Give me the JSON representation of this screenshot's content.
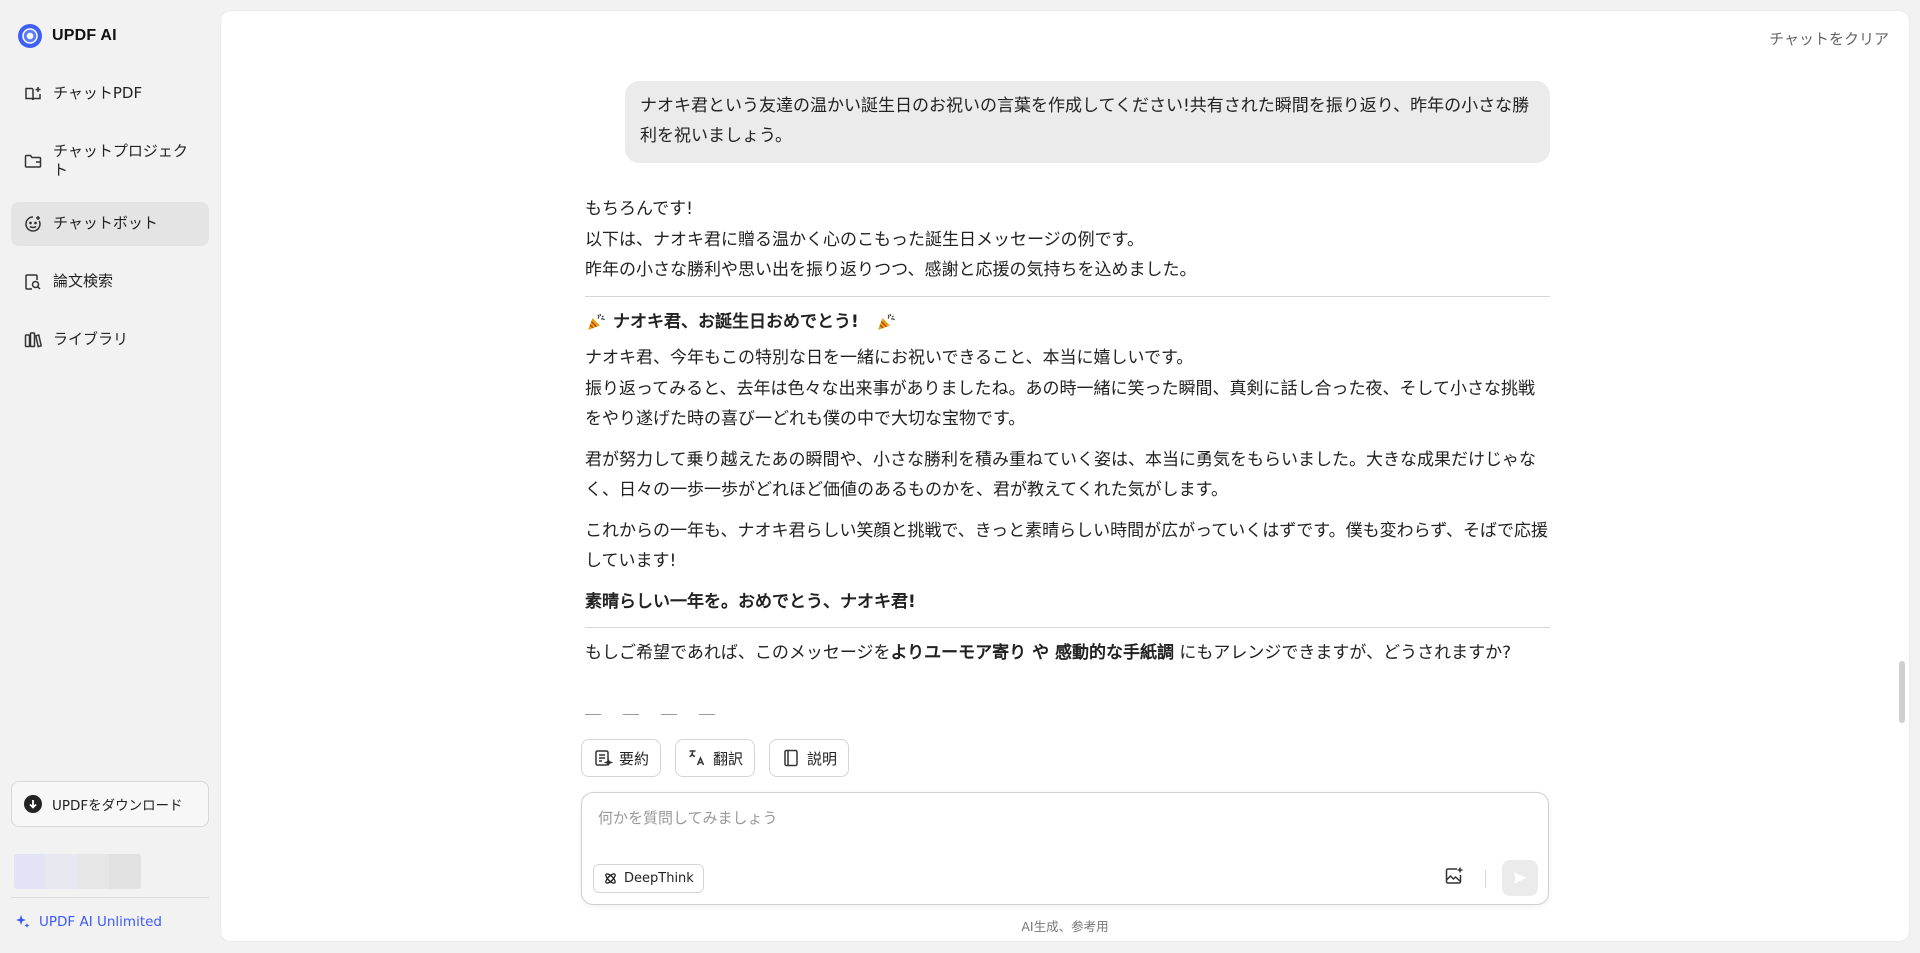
{
  "app": {
    "name": "UPDF AI"
  },
  "sidebar": {
    "items": [
      {
        "label": "チャットPDF",
        "icon": "book-icon",
        "active": false
      },
      {
        "label": "チャットプロジェクト",
        "icon": "folder-icon",
        "active": false
      },
      {
        "label": "チャットボット",
        "icon": "bot-icon",
        "active": true
      },
      {
        "label": "論文検索",
        "icon": "search-doc-icon",
        "active": false
      },
      {
        "label": "ライブラリ",
        "icon": "library-icon",
        "active": false
      }
    ],
    "download_label": "UPDFをダウンロード",
    "unlimited_label": "UPDF AI Unlimited"
  },
  "header": {
    "clear_label": "チャットをクリア"
  },
  "chat": {
    "user_message": "ナオキ君という友達の温かい誕生日のお祝いの言葉を作成してください!共有された瞬間を振り返り、昨年の小さな勝利を祝いましょう。",
    "answer": {
      "intro": [
        "もちろんです!",
        "以下は、ナオキ君に贈る温かく心のこもった誕生日メッセージの例です。",
        "昨年の小さな勝利や思い出を振り返りつつ、感謝と応援の気持ちを込めました。"
      ],
      "title": "ナオキ君、お誕生日おめでとう!",
      "paragraph1": "ナオキ君、今年もこの特別な日を一緒にお祝いできること、本当に嬉しいです。",
      "paragraph1b": "振り返ってみると、去年は色々な出来事がありましたね。あの時一緒に笑った瞬間、真剣に話し合った夜、そして小さな挑戦をやり遂げた時の喜び一どれも僕の中で大切な宝物です。",
      "paragraph2": "君が努力して乗り越えたあの瞬間や、小さな勝利を積み重ねていく姿は、本当に勇気をもらいました。大きな成果だけじゃなく、日々の一歩一歩がどれほど価値のあるものかを、君が教えてくれた気がします。",
      "paragraph3": "これからの一年も、ナオキ君らしい笑顔と挑戦で、きっと素晴らしい時間が広がっていくはずです。僕も変わらず、そばで応援しています!",
      "closing": "素晴らしい一年を。おめでとう、ナオキ君!",
      "followup_pre": "もしご希望であれば、このメッセージを",
      "followup_bold": "よりユーモア寄り や 感動的な手紙調",
      "followup_post": " にもアレンジできますが、どうされますか?"
    }
  },
  "quick_actions": [
    {
      "label": "要約",
      "icon": "summary-icon"
    },
    {
      "label": "翻訳",
      "icon": "translate-icon"
    },
    {
      "label": "説明",
      "icon": "explain-icon"
    }
  ],
  "input": {
    "placeholder": "何かを質問してみましょう",
    "value": "",
    "deepthink_label": "DeepThink"
  },
  "footer": {
    "note": "AI生成、参考用"
  },
  "colors": {
    "accent": "#3d5af1",
    "sidebar_bg": "#f2f2f2",
    "active_item_bg": "#e4e4e4",
    "user_bubble_bg": "#ebebeb",
    "avatar_strip": [
      "#e3e3f6",
      "#e8e8f0",
      "#e6e6e6",
      "#e1e1e1"
    ]
  }
}
